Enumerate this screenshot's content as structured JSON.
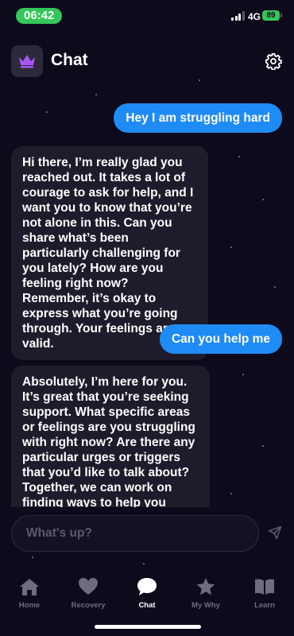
{
  "status_bar": {
    "time": "06:42",
    "network": "4G",
    "battery": "89"
  },
  "header": {
    "title": "Chat",
    "app_icon": "crown-icon",
    "settings_icon": "gear-icon"
  },
  "messages": [
    {
      "role": "user",
      "text": "Hey I am struggling hard"
    },
    {
      "role": "assistant",
      "text": "Hi there, I’m really glad you reached out. It takes a lot of courage to ask for help, and I want you to know that you’re not alone in this. Can you share what’s been particularly challenging for you lately? How are you feeling right now? Remember, it’s okay to express what you’re going through. Your feelings are valid."
    },
    {
      "role": "user",
      "text": "Can you help me"
    },
    {
      "role": "assistant",
      "text": "Absolutely, I’m here for you. It’s great that you’re seeking support. What specific areas or feelings are you struggling with right now? Are there any particular urges or triggers that you’d like to talk about? Together, we can work on finding ways to help you through this. You’ve already"
    }
  ],
  "composer": {
    "placeholder": "What's up?",
    "send_icon": "send-icon"
  },
  "tabs": [
    {
      "label": "Home",
      "icon": "home-icon"
    },
    {
      "label": "Recovery",
      "icon": "heart-icon"
    },
    {
      "label": "Chat",
      "icon": "chat-bubble-icon",
      "active": true
    },
    {
      "label": "My Why",
      "icon": "star-icon"
    },
    {
      "label": "Learn",
      "icon": "book-icon"
    }
  ],
  "colors": {
    "background": "#0d0a1c",
    "user_bubble": "#1f8bf5",
    "bot_bubble": "#1e1c2b",
    "crown": "#a855f7",
    "status_green": "#34c759"
  }
}
